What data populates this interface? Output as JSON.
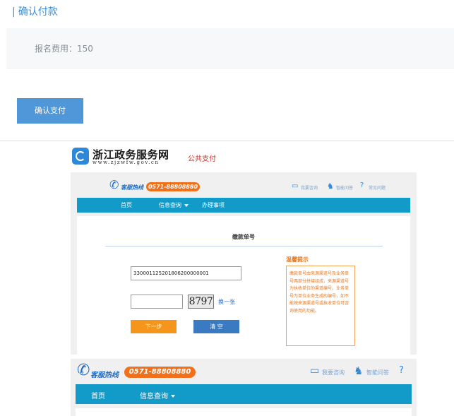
{
  "confirm_panel": {
    "section_title": "确认付款",
    "fee_text": "报名费用：150",
    "confirm_button": "确认支付"
  },
  "portal": {
    "site_name": "浙江政务服务网",
    "site_url": "www.zjzwfw.gov.cn",
    "public_pay": "公共支付",
    "hotline_label": "客服热线",
    "hotline_number": "0571-88808880",
    "tools": [
      {
        "icon": "chat-icon",
        "label": "我要咨询"
      },
      {
        "icon": "smart-assistant-icon",
        "label": "智能问答"
      },
      {
        "icon": "help-icon",
        "label": "常见问题"
      }
    ],
    "nav": [
      "首页",
      "信息查询",
      "办理事项"
    ],
    "card_title": "缴款单号",
    "order_number": "330001125201806200000001",
    "captcha_text": "8797",
    "refresh_link": "换一张",
    "next_button": "下一步",
    "clear_button": "清 空",
    "tips_title": "温馨提示",
    "tips_body": "缴款单号由来源渠道号及业务单号两部分拼接组成，来源渠道号为执收单位的渠道编号，业务单号为单位业务生成的编号，如不能按来源渠道号或执收单位可咨询使用的功能。"
  },
  "lower_view": {
    "hotline_label": "客服热线",
    "hotline_number": "0571-88808880",
    "tools": [
      {
        "icon": "chat-icon",
        "label": "我要咨询"
      },
      {
        "icon": "smart-assistant-icon",
        "label": "智能问答"
      }
    ],
    "nav": [
      "首页",
      "信息查询"
    ]
  },
  "colors": {
    "accent_blue": "#4f97d8",
    "nav_teal": "#129bc8",
    "hotline_orange": "#f0701b",
    "next_orange": "#f5951b",
    "clear_blue": "#3a7ac0",
    "tips_orange": "#e8761c"
  }
}
